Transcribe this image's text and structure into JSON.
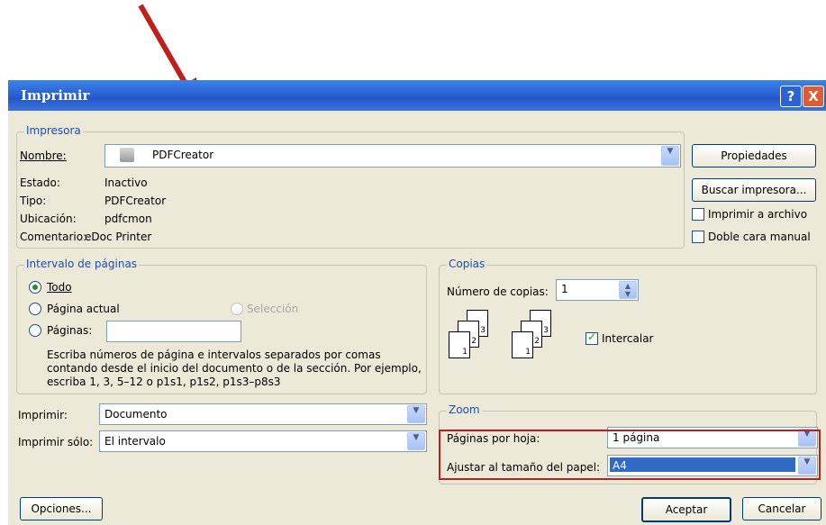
{
  "dialog": {
    "title": "Imprimir",
    "help_icon": "?",
    "close_icon": "X"
  },
  "printer": {
    "group_label": "Impresora",
    "name_label": "Nombre:",
    "name_value": "PDFCreator",
    "status_label": "Estado:",
    "status_value": "Inactivo",
    "type_label": "Tipo:",
    "type_value": "PDFCreator",
    "location_label": "Ubicación:",
    "location_value": "pdfcmon",
    "comment_label": "Comentario:",
    "comment_value": "eDoc Printer",
    "properties_button": "Propiedades",
    "find_printer_button": "Buscar impresora...",
    "print_to_file_label": "Imprimir a archivo",
    "duplex_label": "Doble cara manual"
  },
  "page_range": {
    "group_label": "Intervalo de páginas",
    "all_label": "Todo",
    "current_label": "Página actual",
    "selection_label": "Selección",
    "pages_label": "Páginas:",
    "pages_value": "",
    "help_text_1": "Escriba números de página e intervalos separados por comas",
    "help_text_2": "contando desde el inicio del documento o de la sección. Por ejemplo,",
    "help_text_3": "escriba 1, 3, 5–12 o p1s1, p1s2, p1s3–p8s3"
  },
  "copies": {
    "group_label": "Copias",
    "count_label": "Número de copias:",
    "count_value": "1",
    "collate_label": "Intercalar",
    "collate_checked": true
  },
  "print_what": {
    "label": "Imprimir:",
    "value": "Documento"
  },
  "print_only": {
    "label": "Imprimir sólo:",
    "value": "El intervalo"
  },
  "zoom": {
    "group_label": "Zoom",
    "pages_per_sheet_label": "Páginas por hoja:",
    "pages_per_sheet_value": "1 página",
    "scale_to_paper_label": "Ajustar al tamaño del papel:",
    "scale_to_paper_value": "A4"
  },
  "footer": {
    "options_button": "Opciones...",
    "ok_button": "Aceptar",
    "cancel_button": "Cancelar"
  },
  "annotation": {
    "arrow_color": "#c0201c",
    "highlight_color": "#c0201c"
  }
}
